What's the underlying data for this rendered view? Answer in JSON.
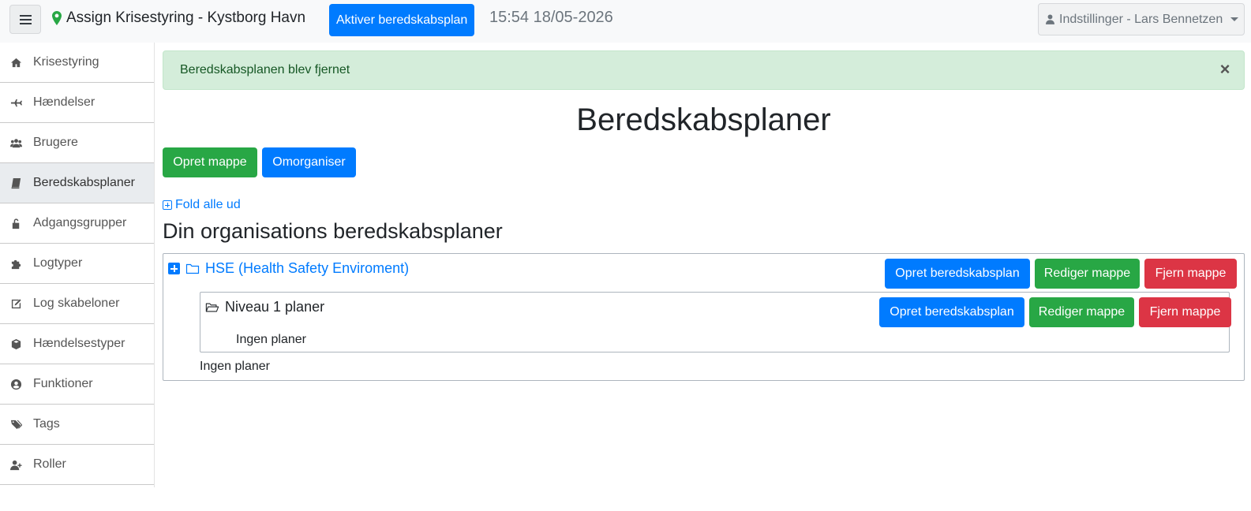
{
  "topbar": {
    "menu_icon": "hamburger-icon",
    "pin_icon": "map-marker-icon",
    "app_title": "Assign Krisestyring - Kystborg Havn",
    "activate_button": "Aktiver beredskabsplan",
    "clock": "15:54 18/05-2026",
    "settings_label": "Indstillinger - Lars Bennetzen",
    "settings_icon": "user-icon"
  },
  "sidebar": {
    "items": [
      {
        "label": "Krisestyring",
        "icon": "home-icon"
      },
      {
        "label": "Hændelser",
        "icon": "plane-icon"
      },
      {
        "label": "Brugere",
        "icon": "users-icon"
      },
      {
        "label": "Beredskabsplaner",
        "icon": "book-icon",
        "active": true
      },
      {
        "label": "Adgangsgrupper",
        "icon": "unlock-icon"
      },
      {
        "label": "Logtyper",
        "icon": "puzzle-icon"
      },
      {
        "label": "Log skabeloner",
        "icon": "edit-icon"
      },
      {
        "label": "Hændelsestyper",
        "icon": "cube-icon"
      },
      {
        "label": "Funktioner",
        "icon": "user-circle-icon"
      },
      {
        "label": "Tags",
        "icon": "tags-icon"
      },
      {
        "label": "Roller",
        "icon": "user-plus-icon"
      }
    ]
  },
  "alert": {
    "message": "Beredskabsplanen blev fjernet",
    "close": "×"
  },
  "main": {
    "title": "Beredskabsplaner",
    "create_folder_button": "Opret mappe",
    "reorganize_button": "Omorganiser",
    "fold_all_link": "Fold alle ud",
    "section_title": "Din organisations beredskabsplaner"
  },
  "folders": {
    "root": {
      "name": "HSE (Health Safety Enviroment)",
      "create_plan_button": "Opret beredskabsplan",
      "edit_folder_button": "Rediger mappe",
      "remove_folder_button": "Fjern mappe",
      "empty_text": "Ingen planer"
    },
    "child": {
      "name": "Niveau 1 planer",
      "create_plan_button": "Opret beredskabsplan",
      "edit_folder_button": "Rediger mappe",
      "remove_folder_button": "Fjern mappe",
      "empty_text": "Ingen planer"
    }
  },
  "colors": {
    "primary": "#007bff",
    "success": "#28a745",
    "danger": "#dc3545",
    "alert_bg": "#d4edda"
  }
}
